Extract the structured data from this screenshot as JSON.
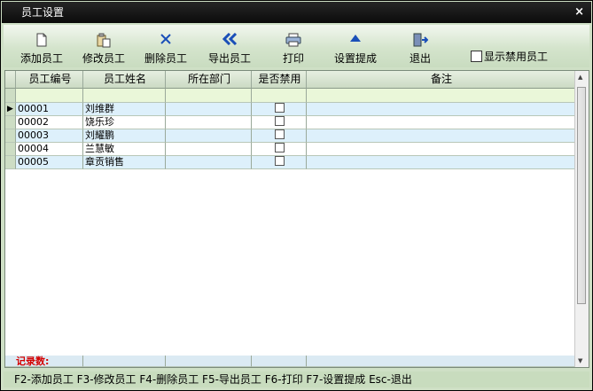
{
  "window": {
    "title": "员工设置",
    "close_glyph": "×"
  },
  "toolbar": {
    "buttons": [
      {
        "label": "添加员工",
        "icon": "document-icon"
      },
      {
        "label": "修改员工",
        "icon": "clipboard-icon"
      },
      {
        "label": "删除员工",
        "icon": "delete-x-icon"
      },
      {
        "label": "导出员工",
        "icon": "double-chevron-left-icon"
      },
      {
        "label": "打印",
        "icon": "printer-icon"
      },
      {
        "label": "设置提成",
        "icon": "triangle-up-icon"
      },
      {
        "label": "退出",
        "icon": "exit-door-icon"
      }
    ],
    "show_disabled_label": "显示禁用员工",
    "show_disabled_checked": false
  },
  "grid": {
    "columns": [
      "员工编号",
      "员工姓名",
      "所在部门",
      "是否禁用",
      "备注"
    ],
    "rows": [
      {
        "id": "00001",
        "name": "刘维群",
        "dept": "",
        "disabled": false,
        "note": ""
      },
      {
        "id": "00002",
        "name": "饶乐珍",
        "dept": "",
        "disabled": false,
        "note": ""
      },
      {
        "id": "00003",
        "name": "刘耀鹏",
        "dept": "",
        "disabled": false,
        "note": ""
      },
      {
        "id": "00004",
        "name": "兰慧敏",
        "dept": "",
        "disabled": false,
        "note": ""
      },
      {
        "id": "00005",
        "name": "章贡销售",
        "dept": "",
        "disabled": false,
        "note": ""
      }
    ],
    "footer_label": "记录数:"
  },
  "status": {
    "text": "F2-添加员工 F3-修改员工 F4-删除员工 F5-导出员工 F6-打印 F7-设置提成 Esc-退出"
  },
  "colors": {
    "accent_red": "#d40000",
    "icon_blue": "#1a4fb8"
  }
}
